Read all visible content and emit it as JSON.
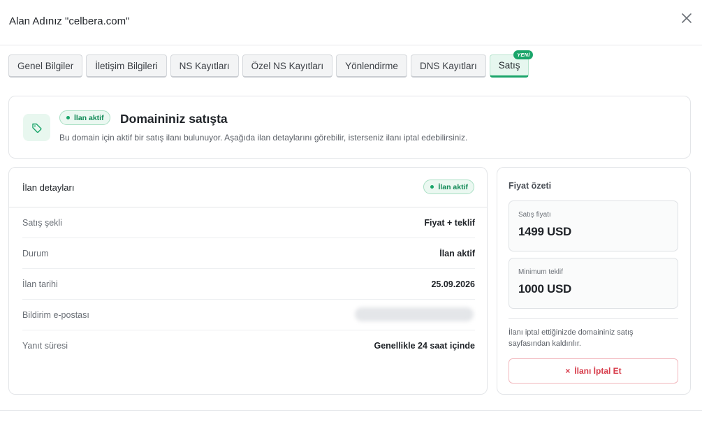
{
  "header": {
    "title": "Alan Adınız \"celbera.com\""
  },
  "tabs": [
    {
      "label": "Genel Bilgiler"
    },
    {
      "label": "İletişim Bilgileri"
    },
    {
      "label": "NS Kayıtları"
    },
    {
      "label": "Özel NS Kayıtları"
    },
    {
      "label": "Yönlendirme"
    },
    {
      "label": "DNS Kayıtları"
    },
    {
      "label": "Satış",
      "badge": "YENİ",
      "active": true
    }
  ],
  "banner": {
    "icon": "tag-icon",
    "status": "İlan aktif",
    "heading": "Domaininiz satışta",
    "description": "Bu domain için aktif bir satış ilanı bulunuyor. Aşağıda ilan detaylarını görebilir, isterseniz ilanı iptal edebilirsiniz."
  },
  "details": {
    "title": "İlan detayları",
    "status": "İlan aktif",
    "rows": [
      {
        "key": "Satış şekli",
        "value": "Fiyat + teklif"
      },
      {
        "key": "Durum",
        "value": "İlan aktif"
      },
      {
        "key": "İlan tarihi",
        "value": "25.09.2026"
      },
      {
        "key": "Bildirim e-postası",
        "value": ""
      },
      {
        "key": "Yanıt süresi",
        "value": "Genellikle 24 saat içinde"
      }
    ]
  },
  "summary": {
    "title": "Fiyat özeti",
    "sale_price_label": "Satış fiyatı",
    "sale_price": "1499 USD",
    "min_offer_label": "Minimum teklif",
    "min_offer": "1000 USD",
    "note": "İlanı iptal ettiğinizde domaininiz satış sayfasından kaldırılır.",
    "cancel_label": "İlanı İptal Et"
  },
  "colors": {
    "accent": "#1aa56a",
    "danger": "#d73a49"
  }
}
